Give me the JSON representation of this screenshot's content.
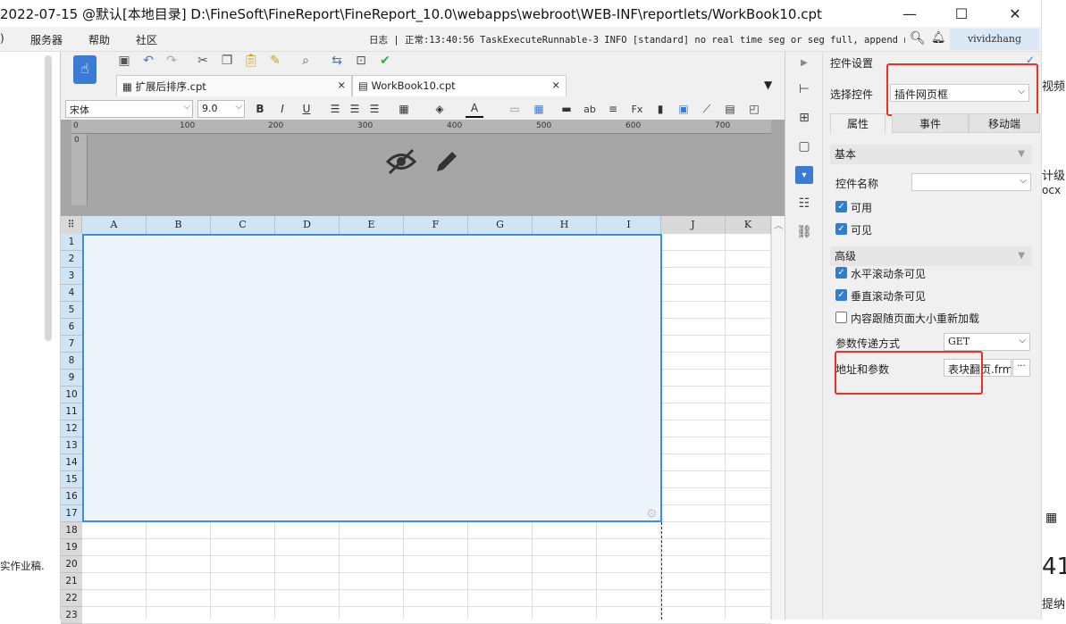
{
  "window": {
    "title": "2022-07-15 @默认[本地目录]    D:\\FineSoft\\FineReport\\FineReport_10.0\\webapps\\webroot\\WEB-INF\\reportlets/WorkBook10.cpt",
    "minimize": "—",
    "maximize": "☐",
    "close": "✕"
  },
  "menubar": {
    "items": [
      ")",
      "服务器",
      "帮助",
      "社区"
    ],
    "log_label": "日志",
    "log_line": "正常:13:40:56 TaskExecuteRunnable-3 INFO [standard] no real time seg or seg full, append n...",
    "user": "vividzhang"
  },
  "tabs": [
    {
      "label": "扩展后排序.cpt",
      "close": "×"
    },
    {
      "label": "WorkBook10.cpt",
      "close": "×"
    }
  ],
  "format_bar": {
    "font": "宋体",
    "size": "9.0",
    "bold": "B",
    "italic": "I",
    "underline": "U"
  },
  "ruler": {
    "marks": [
      "0",
      "100",
      "200",
      "300",
      "400",
      "500",
      "600",
      "700"
    ],
    "vertical_mark": "0"
  },
  "grid": {
    "columns": [
      "A",
      "B",
      "C",
      "D",
      "E",
      "F",
      "G",
      "H",
      "I",
      "J",
      "K"
    ],
    "rows": [
      "1",
      "2",
      "3",
      "4",
      "5",
      "6",
      "7",
      "8",
      "9",
      "10",
      "11",
      "12",
      "13",
      "14",
      "15",
      "16",
      "17",
      "18",
      "19",
      "20",
      "21",
      "22",
      "23"
    ]
  },
  "panel": {
    "header": "控件设置",
    "select_label": "选择控件",
    "select_value": "插件网页框",
    "tabs": [
      "属性",
      "事件",
      "移动端"
    ],
    "basic_section": "基本",
    "name_label": "控件名称",
    "name_value": "",
    "enabled_label": "可用",
    "visible_label": "可见",
    "advanced_section": "高级",
    "hscroll_label": "水平滚动条可见",
    "vscroll_label": "垂直滚动条可见",
    "resize_label": "内容跟随页面大小重新加载",
    "method_label": "参数传递方式",
    "method_value": "GET",
    "url_label": "地址和参数",
    "url_value": "表块翻页.frm",
    "url_btn": "···"
  },
  "left_strip": {
    "text": "实作业稿."
  },
  "far_right": {
    "t1": "视频",
    "t2": "计级",
    "t3": "ocx",
    "t4": "41",
    "t5": "提纳"
  },
  "colors": {
    "selection": "#3d8fdb",
    "highlight": "#e5332a",
    "accent_check": "#2f7fd1"
  }
}
